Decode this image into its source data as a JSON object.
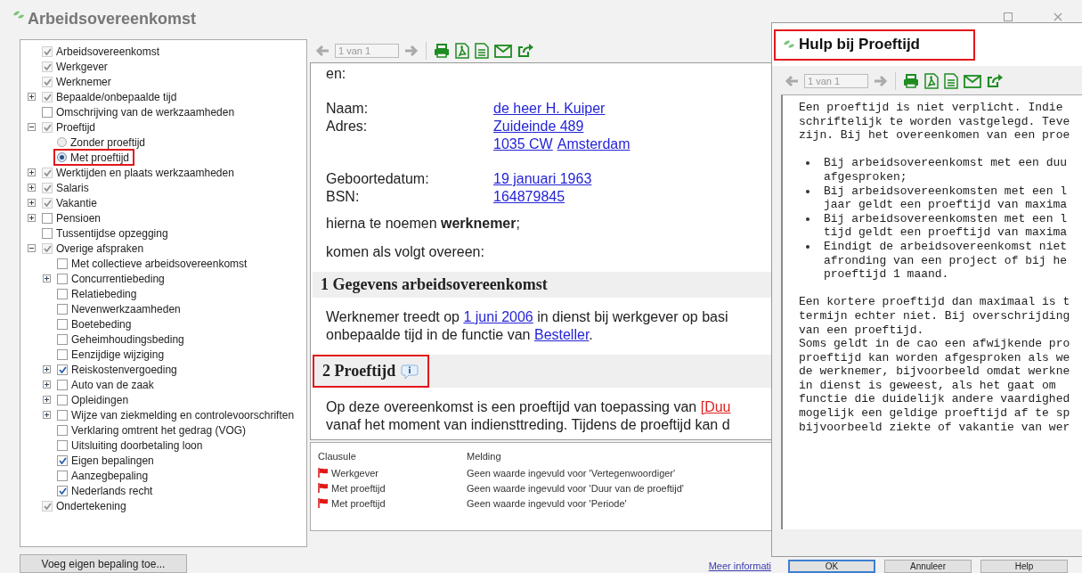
{
  "window": {
    "title": "Arbeidsovereenkomst"
  },
  "tree": {
    "items": [
      {
        "label": "Arbeidsovereenkomst",
        "kind": "checkbox",
        "checked": true,
        "disabled": true
      },
      {
        "label": "Werkgever",
        "kind": "checkbox",
        "checked": true,
        "disabled": true
      },
      {
        "label": "Werknemer",
        "kind": "checkbox",
        "checked": true,
        "disabled": true
      },
      {
        "label": "Bepaalde/onbepaalde tijd",
        "kind": "checkbox",
        "checked": true,
        "disabled": true,
        "expanded": false
      },
      {
        "label": "Omschrijving van de werkzaamheden",
        "kind": "checkbox",
        "checked": false,
        "disabled": false
      },
      {
        "label": "Proeftijd",
        "kind": "checkbox",
        "checked": true,
        "disabled": true,
        "expanded": true,
        "children": [
          {
            "label": "Zonder proeftijd",
            "kind": "radio",
            "selected": false,
            "highlighted": false
          },
          {
            "label": "Met proeftijd",
            "kind": "radio",
            "selected": true,
            "highlighted": true
          }
        ]
      },
      {
        "label": "Werktijden en plaats werkzaamheden",
        "kind": "checkbox",
        "checked": true,
        "disabled": true,
        "expanded": false
      },
      {
        "label": "Salaris",
        "kind": "checkbox",
        "checked": true,
        "disabled": true,
        "expanded": false
      },
      {
        "label": "Vakantie",
        "kind": "checkbox",
        "checked": true,
        "disabled": true,
        "expanded": false
      },
      {
        "label": "Pensioen",
        "kind": "checkbox",
        "checked": false,
        "disabled": false,
        "expanded": false
      },
      {
        "label": "Tussentijdse opzegging",
        "kind": "checkbox",
        "checked": false,
        "disabled": false
      },
      {
        "label": "Overige afspraken",
        "kind": "checkbox",
        "checked": true,
        "disabled": true,
        "expanded": true,
        "children": [
          {
            "label": "Met collectieve arbeidsovereenkomst",
            "kind": "checkbox",
            "checked": false,
            "disabled": false
          },
          {
            "label": "Concurrentiebeding",
            "kind": "checkbox",
            "checked": false,
            "disabled": false,
            "expanded": false
          },
          {
            "label": "Relatiebeding",
            "kind": "checkbox",
            "checked": false,
            "disabled": false
          },
          {
            "label": "Nevenwerkzaamheden",
            "kind": "checkbox",
            "checked": false,
            "disabled": false
          },
          {
            "label": "Boetebeding",
            "kind": "checkbox",
            "checked": false,
            "disabled": false
          },
          {
            "label": "Geheimhoudingsbeding",
            "kind": "checkbox",
            "checked": false,
            "disabled": false
          },
          {
            "label": "Eenzijdige wijziging",
            "kind": "checkbox",
            "checked": false,
            "disabled": false
          },
          {
            "label": "Reiskostenvergoeding",
            "kind": "checkbox",
            "checked": true,
            "disabled": false,
            "expanded": false
          },
          {
            "label": "Auto van de zaak",
            "kind": "checkbox",
            "checked": false,
            "disabled": false,
            "expanded": false
          },
          {
            "label": "Opleidingen",
            "kind": "checkbox",
            "checked": false,
            "disabled": false,
            "expanded": false
          },
          {
            "label": "Wijze van ziekmelding en controlevoorschriften",
            "kind": "checkbox",
            "checked": false,
            "disabled": false,
            "expanded": false
          },
          {
            "label": "Verklaring omtrent het gedrag (VOG)",
            "kind": "checkbox",
            "checked": false,
            "disabled": false
          },
          {
            "label": "Uitsluiting doorbetaling loon",
            "kind": "checkbox",
            "checked": false,
            "disabled": false
          },
          {
            "label": "Eigen bepalingen",
            "kind": "checkbox",
            "checked": true,
            "disabled": false
          },
          {
            "label": "Aanzegbepaling",
            "kind": "checkbox",
            "checked": false,
            "disabled": false
          },
          {
            "label": "Nederlands recht",
            "kind": "checkbox",
            "checked": true,
            "disabled": false
          }
        ]
      },
      {
        "label": "Ondertekening",
        "kind": "checkbox",
        "checked": true,
        "disabled": true
      }
    ]
  },
  "document": {
    "toolbar": {
      "page": "1 van 1"
    },
    "blocks": [
      {
        "kind": "para",
        "lines": [
          [
            {
              "text": "en:"
            }
          ]
        ]
      },
      {
        "kind": "fields",
        "rows": [
          {
            "label": "Naam:",
            "lines": [
              [
                {
                  "link": "de heer H. Kuiper",
                  "missing": false
                }
              ]
            ]
          },
          {
            "label": "Adres:",
            "lines": [
              [
                {
                  "link": "Zuideinde 489",
                  "missing": false
                }
              ],
              [
                {
                  "link": "1035 CW",
                  "missing": false
                },
                {
                  "link": "Amsterdam",
                  "missing": false
                }
              ]
            ]
          }
        ]
      },
      {
        "kind": "fields",
        "rows": [
          {
            "label": "Geboortedatum:",
            "lines": [
              [
                {
                  "link": "19 januari 1963",
                  "missing": false
                }
              ]
            ]
          },
          {
            "label": "BSN:",
            "lines": [
              [
                {
                  "link": "164879845",
                  "missing": false
                }
              ]
            ]
          }
        ]
      },
      {
        "kind": "para",
        "lines": [
          [
            {
              "text": "hierna te noemen **werknemer**;"
            }
          ]
        ]
      },
      {
        "kind": "para",
        "lines": [
          [
            {
              "text": "komen als volgt overeen:"
            }
          ]
        ]
      },
      {
        "kind": "heading",
        "text": "1 Gegevens arbeidsovereenkomst",
        "info": false,
        "highlighted": false
      },
      {
        "kind": "para",
        "lines": [
          [
            {
              "text": "Werknemer treedt op "
            },
            {
              "link": "1 juni 2006",
              "missing": false
            },
            {
              "text": " in dienst bij werkgever op basi"
            }
          ],
          [
            {
              "text": "onbepaalde tijd in de functie van "
            },
            {
              "link": "Besteller",
              "missing": false
            },
            {
              "text": "."
            }
          ]
        ]
      },
      {
        "kind": "heading",
        "text": "2 Proeftijd",
        "info": true,
        "highlighted": true
      },
      {
        "kind": "para",
        "lines": [
          [
            {
              "text": "Op deze overeenkomst is een proeftijd van toepassing van "
            },
            {
              "link": "[Duu",
              "missing": true
            }
          ],
          [
            {
              "text": "vanaf het moment van indiensttreding. Tijdens de proeftijd kan d"
            }
          ]
        ]
      }
    ]
  },
  "messages": {
    "columns": [
      "Clausule",
      "Melding"
    ],
    "rows": [
      {
        "clause": "Werkgever",
        "message": "Geen waarde ingevuld voor 'Vertegenwoordiger'"
      },
      {
        "clause": "Met proeftijd",
        "message": "Geen waarde ingevuld voor 'Duur van de proeftijd'"
      },
      {
        "clause": "Met proeftijd",
        "message": "Geen waarde ingevuld voor 'Periode'"
      }
    ]
  },
  "footer": {
    "add_button": "Voeg eigen bepaling toe...",
    "more_info_link": "Meer informati",
    "buttons": [
      {
        "label": "OK",
        "default": true
      },
      {
        "label": "Annuleer",
        "default": false
      },
      {
        "label": "Help",
        "default": false
      }
    ]
  },
  "help_dialog": {
    "title": "Hulp bij Proeftijd",
    "highlighted": true,
    "toolbar": {
      "page": "1 van 1"
    },
    "body": [
      {
        "kind": "para",
        "lines": [
          "Een proeftijd is niet verplicht. Indie",
          "schriftelijk te worden vastgelegd. Teve",
          "zijn. Bij het overeenkomen van een proe"
        ]
      },
      {
        "kind": "bullets",
        "items": [
          [
            "Bij arbeidsovereenkomst met een duu",
            "afgesproken;"
          ],
          [
            "Bij arbeidsovereenkomsten met een l",
            "jaar geldt een proeftijd van maxima"
          ],
          [
            "Bij arbeidsovereenkomsten met een l",
            "tijd geldt een proeftijd van maxima"
          ],
          [
            "Eindigt de arbeidsovereenkomst niet",
            "afronding van een project of bij he",
            "proeftijd 1 maand."
          ]
        ]
      },
      {
        "kind": "para",
        "lines": [
          "Een kortere proeftijd dan maximaal is t",
          "termijn echter niet. Bij overschrijding",
          "van een proeftijd."
        ]
      },
      {
        "kind": "para_tight",
        "lines": [
          "Soms geldt in de cao een afwijkende pro",
          "proeftijd kan worden afgesproken als we",
          "de werknemer, bijvoorbeeld omdat werkne",
          "in dienst is geweest, als het gaat om",
          "functie die duidelijk andere vaardighed",
          "mogelijk een geldige proeftijd af te sp",
          "bijvoorbeeld ziekte of vakantie van wer"
        ]
      }
    ]
  }
}
